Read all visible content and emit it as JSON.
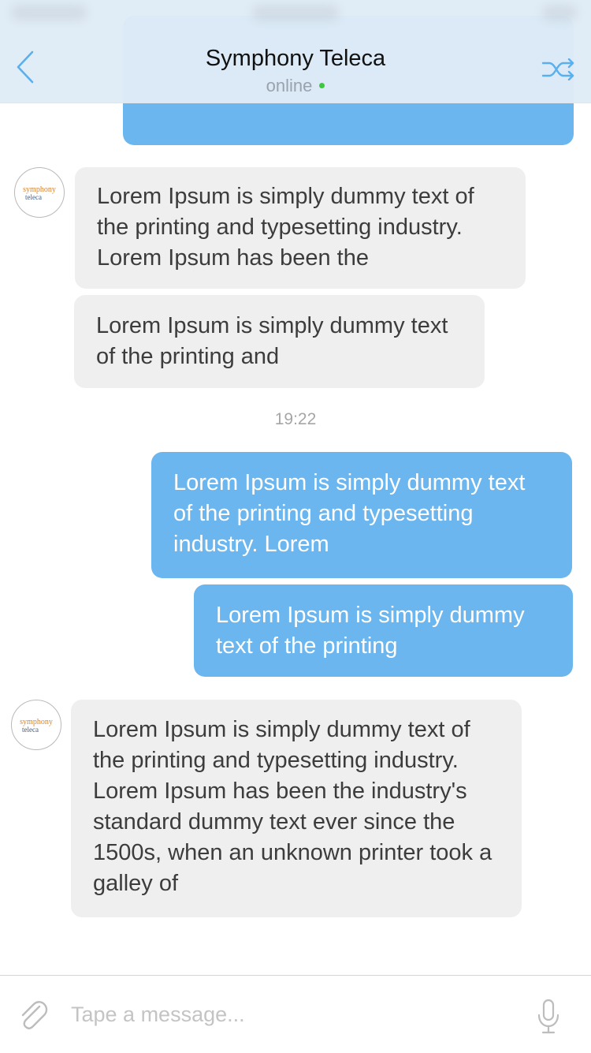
{
  "header": {
    "title": "Symphony Teleca",
    "status": "online",
    "online_color": "#3cc83c",
    "accent_color": "#5ab0ee"
  },
  "contact_avatar": {
    "line1": "symphony",
    "line2": "teleca"
  },
  "messages": [
    {
      "direction": "out",
      "text": ""
    },
    {
      "direction": "in",
      "text": "Lorem Ipsum is simply dummy text of the printing and typesetting industry. Lorem Ipsum has been the"
    },
    {
      "direction": "in",
      "text": "Lorem Ipsum is simply dummy text of the printing and"
    },
    {
      "direction": "out",
      "text": "Lorem Ipsum is simply dummy text of the printing and typesetting industry. Lorem"
    },
    {
      "direction": "out",
      "text": "Lorem Ipsum is simply dummy text of the printing"
    },
    {
      "direction": "in",
      "text": "Lorem Ipsum is simply dummy text of the printing and typesetting industry. Lorem Ipsum has been the industry's standard dummy text ever since the 1500s, when an unknown printer took a galley of"
    }
  ],
  "time_separator": "19:22",
  "composer": {
    "placeholder": "Tape a message...",
    "value": ""
  },
  "icons": {
    "back": "chevron-left-icon",
    "shuffle": "shuffle-icon",
    "attach": "paperclip-icon",
    "mic": "microphone-icon"
  },
  "colors": {
    "incoming_bubble": "#efefef",
    "outgoing_bubble": "#6cb6ef",
    "header_bg": "#e0ecf6"
  }
}
